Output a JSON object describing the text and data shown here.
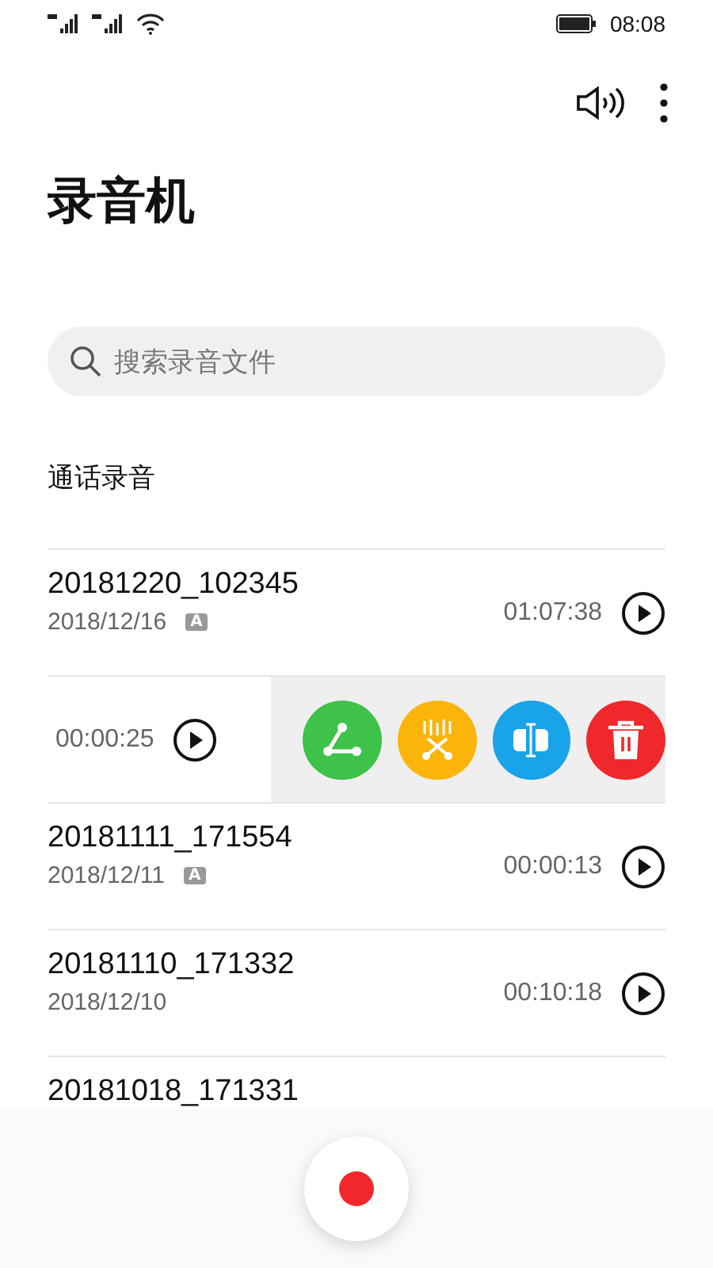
{
  "status_bar": {
    "time": "08:08"
  },
  "title": "录音机",
  "search": {
    "placeholder": "搜索录音文件"
  },
  "section": "通话录音",
  "recordings": [
    {
      "kind": "normal",
      "name": "20181220_102345",
      "date": "2018/12/16",
      "auto_badge": "A",
      "duration": "01:07:38"
    },
    {
      "kind": "swiped",
      "duration": "00:00:25",
      "actions": [
        {
          "kind": "share",
          "color": "#3ec24a"
        },
        {
          "kind": "cut",
          "color": "#fbb50a"
        },
        {
          "kind": "split",
          "color": "#19a3e8"
        },
        {
          "kind": "delete",
          "color": "#f0282c"
        }
      ]
    },
    {
      "kind": "normal",
      "name": "20181111_171554",
      "date": "2018/12/11",
      "auto_badge": "A",
      "duration": "00:00:13"
    },
    {
      "kind": "normal",
      "name": "20181110_171332",
      "date": "2018/12/10",
      "duration": "00:10:18"
    },
    {
      "kind": "normal",
      "name": "20181018_171331"
    }
  ]
}
